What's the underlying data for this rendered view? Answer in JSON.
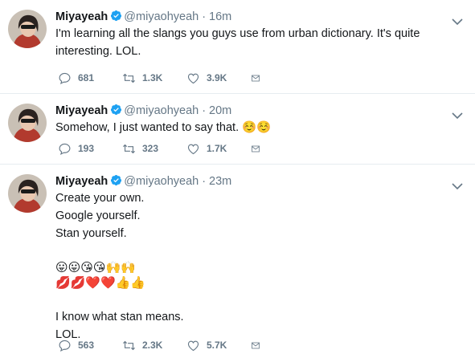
{
  "tweets": [
    {
      "name": "Miyayeah",
      "handle": "@miyaohyeah",
      "dot": "·",
      "time": "16m",
      "lines": [
        "I'm learning all the slangs you guys use from urban dictionary. It's quite",
        "interesting. LOL."
      ],
      "replies": "681",
      "retweets": "1.3K",
      "likes": "3.9K"
    },
    {
      "name": "Miyayeah",
      "handle": "@miyaohyeah",
      "dot": "·",
      "time": "20m",
      "lines": [
        "Somehow, I just wanted to say that. ☺️☺️"
      ],
      "replies": "193",
      "retweets": "323",
      "likes": "1.7K"
    },
    {
      "name": "Miyayeah",
      "handle": "@miyaohyeah",
      "dot": "·",
      "time": "23m",
      "lines": [
        "Create your own.",
        "Google yourself.",
        "Stan yourself."
      ],
      "emoji_row_1": "😛😛😘😘🙌🙌",
      "emoji_row_2": "💋💋❤️❤️👍👍",
      "lines_after": [
        "I know what stan means.",
        "LOL."
      ],
      "replies": "563",
      "retweets": "2.3K",
      "likes": "5.7K"
    }
  ],
  "icons": {
    "verified": "verified-badge-icon",
    "caret": "chevron-down-icon",
    "reply": "reply-icon",
    "retweet": "retweet-icon",
    "like": "heart-icon",
    "dm": "envelope-icon"
  },
  "colors": {
    "verified": "#1da1f2",
    "muted": "#657786",
    "divider": "#e6ecf0"
  }
}
